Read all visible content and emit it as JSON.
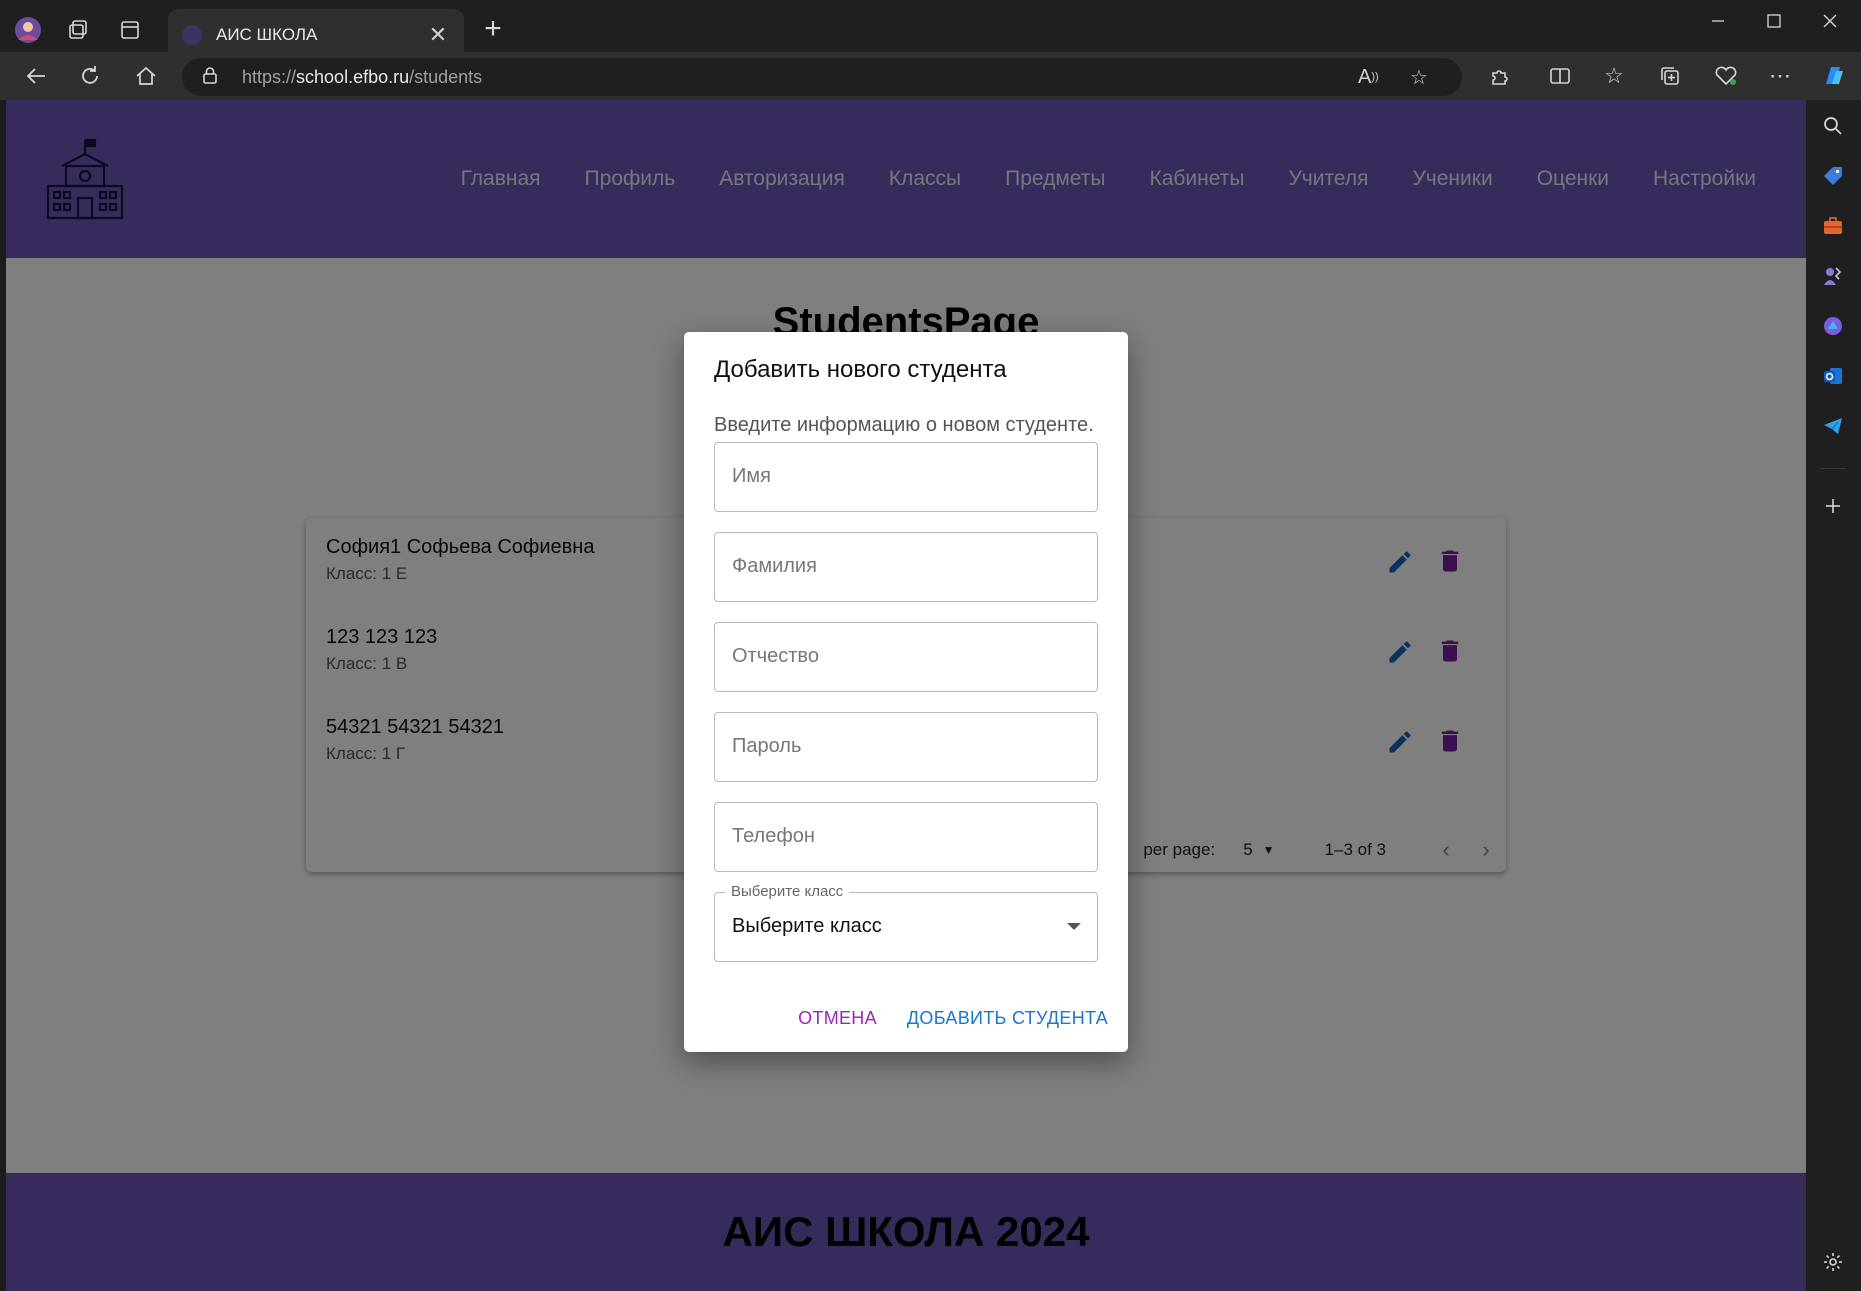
{
  "browser": {
    "tab_title": "АИС ШКОЛА",
    "url_scheme": "https://",
    "url_host": "school.efbo.ru",
    "url_path": "/students",
    "close_tab_glyph": "✕",
    "new_tab_glyph": "+"
  },
  "header": {
    "menu": [
      "Главная",
      "Профиль",
      "Авторизация",
      "Классы",
      "Предметы",
      "Кабинеты",
      "Учителя",
      "Ученики",
      "Оценки",
      "Настройки"
    ],
    "brand_color": "#6f56b8"
  },
  "page": {
    "title": "StudentsPage"
  },
  "students": [
    {
      "name": "София1 Софьева Софиевна",
      "class": "Класс: 1 Е"
    },
    {
      "name": "123 123 123",
      "class": "Класс: 1 В"
    },
    {
      "name": "54321 54321 54321",
      "class": "Класс: 1 Г"
    }
  ],
  "pagination": {
    "rows_label": "per page:",
    "rows_value": "5",
    "range": "1–3 of 3"
  },
  "dialog": {
    "title": "Добавить нового студента",
    "description": "Введите информацию о новом студенте.",
    "fields": {
      "first_name": "Имя",
      "last_name": "Фамилия",
      "patronymic": "Отчество",
      "password": "Пароль",
      "phone": "Телефон"
    },
    "class_select": {
      "label": "Выберите класс",
      "value": "Выберите класс"
    },
    "cancel_label": "ОТМЕНА",
    "submit_label": "ДОБАВИТЬ СТУДЕНТА"
  },
  "footer": {
    "text": "АИС ШКОЛА 2024"
  },
  "colors": {
    "edit": "#1565c0",
    "delete": "#7b1fa2",
    "cancel": "#9b27b0",
    "submit": "#1976d2"
  }
}
